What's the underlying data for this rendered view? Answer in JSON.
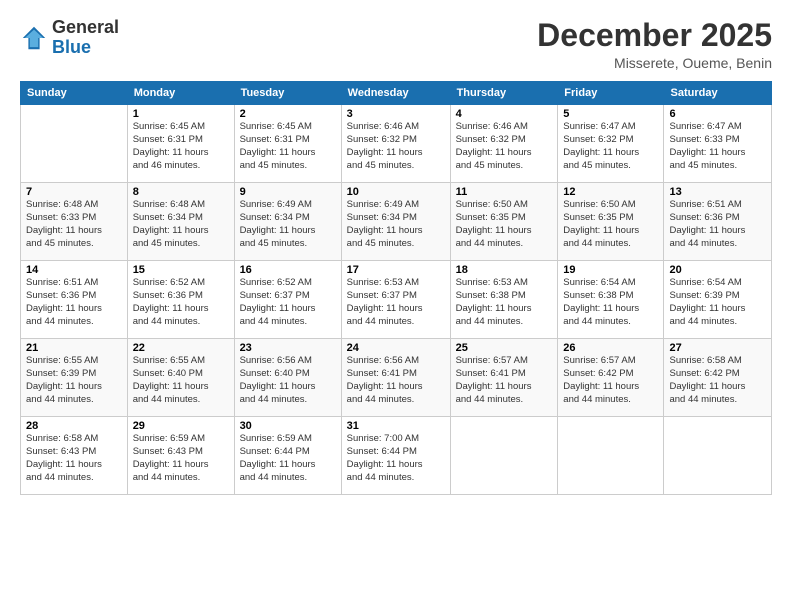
{
  "logo": {
    "general": "General",
    "blue": "Blue"
  },
  "title": "December 2025",
  "subtitle": "Misserete, Oueme, Benin",
  "header_days": [
    "Sunday",
    "Monday",
    "Tuesday",
    "Wednesday",
    "Thursday",
    "Friday",
    "Saturday"
  ],
  "weeks": [
    [
      {
        "day": "",
        "info": ""
      },
      {
        "day": "1",
        "info": "Sunrise: 6:45 AM\nSunset: 6:31 PM\nDaylight: 11 hours\nand 46 minutes."
      },
      {
        "day": "2",
        "info": "Sunrise: 6:45 AM\nSunset: 6:31 PM\nDaylight: 11 hours\nand 45 minutes."
      },
      {
        "day": "3",
        "info": "Sunrise: 6:46 AM\nSunset: 6:32 PM\nDaylight: 11 hours\nand 45 minutes."
      },
      {
        "day": "4",
        "info": "Sunrise: 6:46 AM\nSunset: 6:32 PM\nDaylight: 11 hours\nand 45 minutes."
      },
      {
        "day": "5",
        "info": "Sunrise: 6:47 AM\nSunset: 6:32 PM\nDaylight: 11 hours\nand 45 minutes."
      },
      {
        "day": "6",
        "info": "Sunrise: 6:47 AM\nSunset: 6:33 PM\nDaylight: 11 hours\nand 45 minutes."
      }
    ],
    [
      {
        "day": "7",
        "info": "Sunrise: 6:48 AM\nSunset: 6:33 PM\nDaylight: 11 hours\nand 45 minutes."
      },
      {
        "day": "8",
        "info": "Sunrise: 6:48 AM\nSunset: 6:34 PM\nDaylight: 11 hours\nand 45 minutes."
      },
      {
        "day": "9",
        "info": "Sunrise: 6:49 AM\nSunset: 6:34 PM\nDaylight: 11 hours\nand 45 minutes."
      },
      {
        "day": "10",
        "info": "Sunrise: 6:49 AM\nSunset: 6:34 PM\nDaylight: 11 hours\nand 45 minutes."
      },
      {
        "day": "11",
        "info": "Sunrise: 6:50 AM\nSunset: 6:35 PM\nDaylight: 11 hours\nand 44 minutes."
      },
      {
        "day": "12",
        "info": "Sunrise: 6:50 AM\nSunset: 6:35 PM\nDaylight: 11 hours\nand 44 minutes."
      },
      {
        "day": "13",
        "info": "Sunrise: 6:51 AM\nSunset: 6:36 PM\nDaylight: 11 hours\nand 44 minutes."
      }
    ],
    [
      {
        "day": "14",
        "info": "Sunrise: 6:51 AM\nSunset: 6:36 PM\nDaylight: 11 hours\nand 44 minutes."
      },
      {
        "day": "15",
        "info": "Sunrise: 6:52 AM\nSunset: 6:36 PM\nDaylight: 11 hours\nand 44 minutes."
      },
      {
        "day": "16",
        "info": "Sunrise: 6:52 AM\nSunset: 6:37 PM\nDaylight: 11 hours\nand 44 minutes."
      },
      {
        "day": "17",
        "info": "Sunrise: 6:53 AM\nSunset: 6:37 PM\nDaylight: 11 hours\nand 44 minutes."
      },
      {
        "day": "18",
        "info": "Sunrise: 6:53 AM\nSunset: 6:38 PM\nDaylight: 11 hours\nand 44 minutes."
      },
      {
        "day": "19",
        "info": "Sunrise: 6:54 AM\nSunset: 6:38 PM\nDaylight: 11 hours\nand 44 minutes."
      },
      {
        "day": "20",
        "info": "Sunrise: 6:54 AM\nSunset: 6:39 PM\nDaylight: 11 hours\nand 44 minutes."
      }
    ],
    [
      {
        "day": "21",
        "info": "Sunrise: 6:55 AM\nSunset: 6:39 PM\nDaylight: 11 hours\nand 44 minutes."
      },
      {
        "day": "22",
        "info": "Sunrise: 6:55 AM\nSunset: 6:40 PM\nDaylight: 11 hours\nand 44 minutes."
      },
      {
        "day": "23",
        "info": "Sunrise: 6:56 AM\nSunset: 6:40 PM\nDaylight: 11 hours\nand 44 minutes."
      },
      {
        "day": "24",
        "info": "Sunrise: 6:56 AM\nSunset: 6:41 PM\nDaylight: 11 hours\nand 44 minutes."
      },
      {
        "day": "25",
        "info": "Sunrise: 6:57 AM\nSunset: 6:41 PM\nDaylight: 11 hours\nand 44 minutes."
      },
      {
        "day": "26",
        "info": "Sunrise: 6:57 AM\nSunset: 6:42 PM\nDaylight: 11 hours\nand 44 minutes."
      },
      {
        "day": "27",
        "info": "Sunrise: 6:58 AM\nSunset: 6:42 PM\nDaylight: 11 hours\nand 44 minutes."
      }
    ],
    [
      {
        "day": "28",
        "info": "Sunrise: 6:58 AM\nSunset: 6:43 PM\nDaylight: 11 hours\nand 44 minutes."
      },
      {
        "day": "29",
        "info": "Sunrise: 6:59 AM\nSunset: 6:43 PM\nDaylight: 11 hours\nand 44 minutes."
      },
      {
        "day": "30",
        "info": "Sunrise: 6:59 AM\nSunset: 6:44 PM\nDaylight: 11 hours\nand 44 minutes."
      },
      {
        "day": "31",
        "info": "Sunrise: 7:00 AM\nSunset: 6:44 PM\nDaylight: 11 hours\nand 44 minutes."
      },
      {
        "day": "",
        "info": ""
      },
      {
        "day": "",
        "info": ""
      },
      {
        "day": "",
        "info": ""
      }
    ]
  ]
}
